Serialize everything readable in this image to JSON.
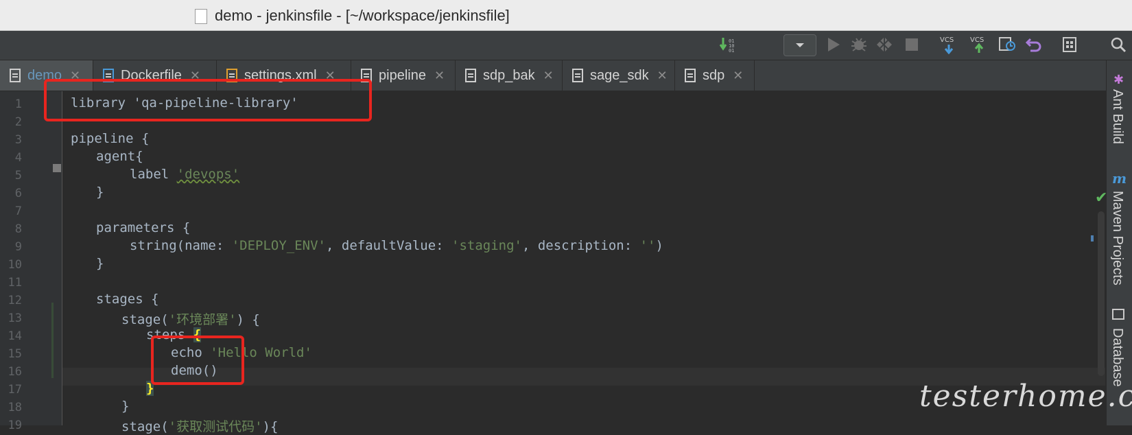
{
  "window": {
    "title": "demo - jenkinsfile - [~/workspace/jenkinsfile]"
  },
  "toolbar": {
    "icons": [
      "vcs-update-icon",
      "run-config-dropdown",
      "run-icon",
      "debug-icon",
      "coverage-icon",
      "stop-icon",
      "vcs-update-project-icon",
      "vcs-commit-icon",
      "history-icon",
      "revert-icon",
      "project-structure-icon",
      "search-icon"
    ],
    "vcs_label": "VCS"
  },
  "tabs": [
    {
      "label": "demo",
      "active": true
    },
    {
      "label": "Dockerfile",
      "active": false
    },
    {
      "label": "settings.xml",
      "active": false
    },
    {
      "label": "pipeline",
      "active": false
    },
    {
      "label": "sdp_bak",
      "active": false
    },
    {
      "label": "sage_sdk",
      "active": false
    },
    {
      "label": "sdp",
      "active": false
    }
  ],
  "line_numbers": [
    "1",
    "2",
    "3",
    "4",
    "5",
    "6",
    "7",
    "8",
    "9",
    "10",
    "11",
    "12",
    "13",
    "14",
    "15",
    "16",
    "17",
    "18",
    "19"
  ],
  "code": {
    "l1": "library 'qa-pipeline-library'",
    "l3": "pipeline {",
    "l4": "agent{",
    "l5a": "label ",
    "l5b": "'devops'",
    "l6": "}",
    "l8": "parameters {",
    "l9a": "string(name: ",
    "l9b": "'DEPLOY_ENV'",
    "l9c": ", defaultValue: ",
    "l9d": "'staging'",
    "l9e": ", description: ",
    "l9f": "''",
    "l9g": ")",
    "l10": "}",
    "l12": "stages {",
    "l13a": "stage(",
    "l13b": "'环境部署'",
    "l13c": ") {",
    "l14a": "steps ",
    "l14b": "{",
    "l15a": "echo ",
    "l15b": "'Hello World'",
    "l16": "demo()",
    "l17": "}",
    "l18": "}",
    "l19a": "stage(",
    "l19b": "'获取测试代码'",
    "l19c": "){"
  },
  "tool_windows": [
    "Ant Build",
    "Maven Projects",
    "Database"
  ],
  "watermark": "testerhome.com"
}
